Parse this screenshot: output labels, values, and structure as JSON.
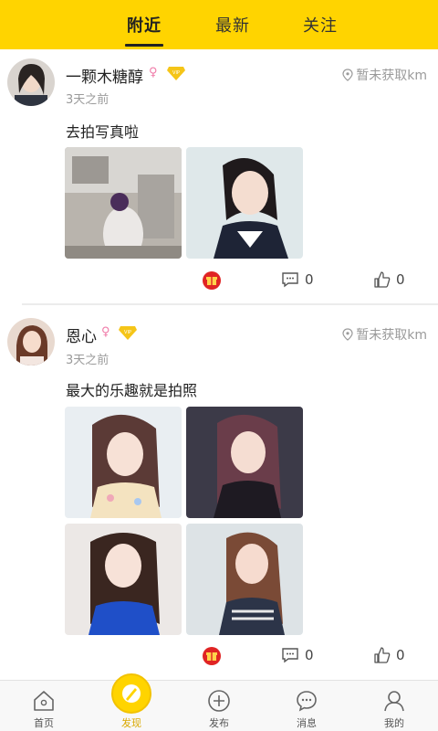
{
  "top_tabs": [
    {
      "label": "附近",
      "active": true
    },
    {
      "label": "最新",
      "active": false
    },
    {
      "label": "关注",
      "active": false
    }
  ],
  "posts": [
    {
      "username": "一颗木糖醇",
      "gender_symbol": "♀",
      "vip_badge": "VIP",
      "time": "3天之前",
      "location": "暂未获取km",
      "text": "去拍写真啦",
      "photo_count": 2,
      "comments": "0",
      "likes": "0"
    },
    {
      "username": "恩心",
      "gender_symbol": "♀",
      "vip_badge": "VIP",
      "time": "3天之前",
      "location": "暂未获取km",
      "text": "最大的乐趣就是拍照",
      "photo_count": 4,
      "comments": "0",
      "likes": "0"
    }
  ],
  "bottom_nav": [
    {
      "label": "首页",
      "icon": "home-icon",
      "active": false
    },
    {
      "label": "发现",
      "icon": "compass-icon",
      "active": true
    },
    {
      "label": "发布",
      "icon": "plus-circle-icon",
      "active": false
    },
    {
      "label": "消息",
      "icon": "chat-icon",
      "active": false
    },
    {
      "label": "我的",
      "icon": "user-icon",
      "active": false
    }
  ],
  "colors": {
    "accent": "#ffd400",
    "nav_active": "#d9a800",
    "gender": "#f07aa8",
    "muted_text": "#9a9a9a"
  }
}
